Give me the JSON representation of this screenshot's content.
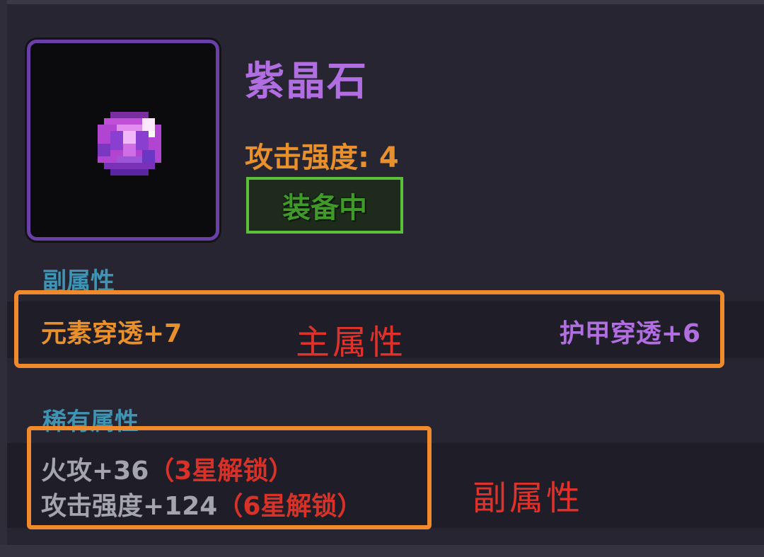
{
  "item": {
    "name": "紫晶石",
    "main_stat": "攻击强度: 4",
    "equipped_label": "装备中",
    "icon": "purple-gem-icon"
  },
  "sections": {
    "sub_attr_title": "副属性",
    "rare_attr_title": "稀有属性"
  },
  "main_attributes": {
    "left": "元素穿透+7",
    "right": "护甲穿透+6"
  },
  "rare_attributes": [
    {
      "stat": "火攻+36",
      "unlock": "（3星解锁）"
    },
    {
      "stat": "攻击强度+124",
      "unlock": "（6星解锁）"
    }
  ],
  "annotations": {
    "main": "主属性",
    "sub": "副属性"
  },
  "colors": {
    "rarity_purple": "#b06ee0",
    "stat_orange": "#e8912c",
    "equipped_green": "#5bbf3a",
    "annotation_red": "#e0322a",
    "highlight_box": "#f18a2c"
  }
}
